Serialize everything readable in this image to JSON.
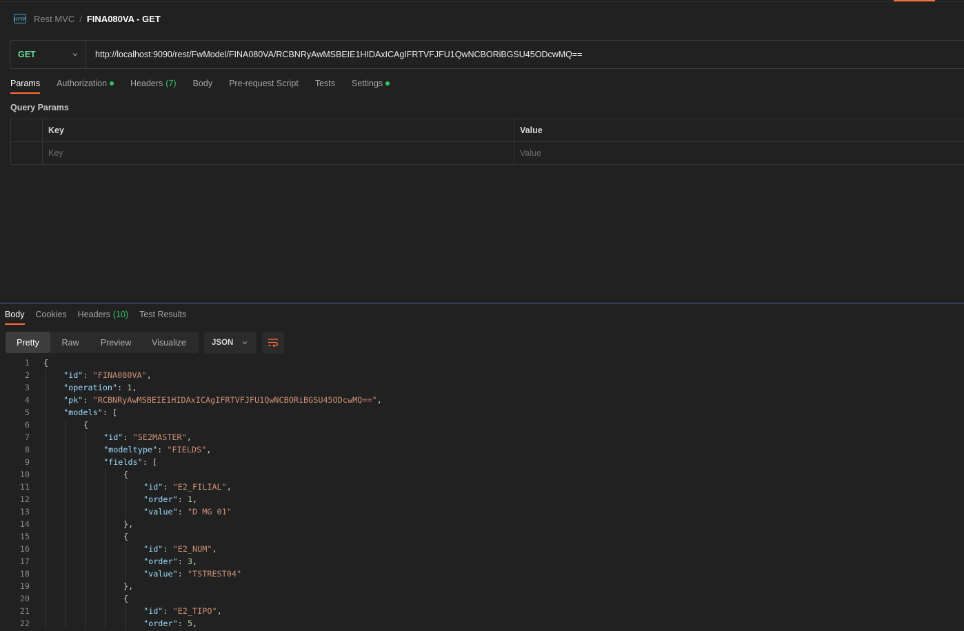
{
  "breadcrumb": {
    "parent": "Rest MVC",
    "separator": "/",
    "current": "FINA080VA - GET"
  },
  "request": {
    "method": "GET",
    "url": "http://localhost:9090/rest/FwModel/FINA080VA/RCBNRyAwMSBEIE1HIDAxICAgIFRTVFJFU1QwNCBORiBGSU45ODcwMQ=="
  },
  "request_tabs": [
    {
      "label": "Params",
      "active": true
    },
    {
      "label": "Authorization",
      "dot": true
    },
    {
      "label": "Headers",
      "count": "(7)"
    },
    {
      "label": "Body"
    },
    {
      "label": "Pre-request Script"
    },
    {
      "label": "Tests"
    },
    {
      "label": "Settings",
      "dot": true
    }
  ],
  "query_params": {
    "title": "Query Params",
    "header_key": "Key",
    "header_value": "Value",
    "placeholder_key": "Key",
    "placeholder_value": "Value"
  },
  "response_tabs": [
    {
      "label": "Body",
      "active": true
    },
    {
      "label": "Cookies"
    },
    {
      "label": "Headers",
      "count": "(10)"
    },
    {
      "label": "Test Results"
    }
  ],
  "viewer": {
    "modes": [
      "Pretty",
      "Raw",
      "Preview",
      "Visualize"
    ],
    "active_mode": "Pretty",
    "format": "JSON",
    "wrap_icon": "wrap-lines-icon"
  },
  "colors": {
    "accent": "#ff6c37",
    "method_get": "#6bdd9a",
    "status_dot": "#2fc768",
    "json_key": "#9cdcfe",
    "json_string": "#ce9178",
    "json_number": "#b5cea8"
  },
  "code_lines": [
    {
      "n": "1",
      "indent": 0,
      "parts": [
        [
          "p",
          "{"
        ]
      ]
    },
    {
      "n": "2",
      "indent": 1,
      "parts": [
        [
          "k",
          "\"id\""
        ],
        [
          "p",
          ": "
        ],
        [
          "s",
          "\"FINA080VA\""
        ],
        [
          "p",
          ","
        ]
      ]
    },
    {
      "n": "3",
      "indent": 1,
      "parts": [
        [
          "k",
          "\"operation\""
        ],
        [
          "p",
          ": "
        ],
        [
          "n",
          "1"
        ],
        [
          "p",
          ","
        ]
      ]
    },
    {
      "n": "4",
      "indent": 1,
      "parts": [
        [
          "k",
          "\"pk\""
        ],
        [
          "p",
          ": "
        ],
        [
          "s",
          "\"RCBNRyAwMSBEIE1HIDAxICAgIFRTVFJFU1QwNCBORiBGSU45ODcwMQ==\""
        ],
        [
          "p",
          ","
        ]
      ]
    },
    {
      "n": "5",
      "indent": 1,
      "parts": [
        [
          "k",
          "\"models\""
        ],
        [
          "p",
          ": ["
        ]
      ]
    },
    {
      "n": "6",
      "indent": 2,
      "parts": [
        [
          "p",
          "{"
        ]
      ]
    },
    {
      "n": "7",
      "indent": 3,
      "parts": [
        [
          "k",
          "\"id\""
        ],
        [
          "p",
          ": "
        ],
        [
          "s",
          "\"SE2MASTER\""
        ],
        [
          "p",
          ","
        ]
      ]
    },
    {
      "n": "8",
      "indent": 3,
      "parts": [
        [
          "k",
          "\"modeltype\""
        ],
        [
          "p",
          ": "
        ],
        [
          "s",
          "\"FIELDS\""
        ],
        [
          "p",
          ","
        ]
      ]
    },
    {
      "n": "9",
      "indent": 3,
      "parts": [
        [
          "k",
          "\"fields\""
        ],
        [
          "p",
          ": ["
        ]
      ]
    },
    {
      "n": "10",
      "indent": 4,
      "parts": [
        [
          "p",
          "{"
        ]
      ]
    },
    {
      "n": "11",
      "indent": 5,
      "parts": [
        [
          "k",
          "\"id\""
        ],
        [
          "p",
          ": "
        ],
        [
          "s",
          "\"E2_FILIAL\""
        ],
        [
          "p",
          ","
        ]
      ]
    },
    {
      "n": "12",
      "indent": 5,
      "parts": [
        [
          "k",
          "\"order\""
        ],
        [
          "p",
          ": "
        ],
        [
          "n",
          "1"
        ],
        [
          "p",
          ","
        ]
      ]
    },
    {
      "n": "13",
      "indent": 5,
      "parts": [
        [
          "k",
          "\"value\""
        ],
        [
          "p",
          ": "
        ],
        [
          "s",
          "\"D MG 01\""
        ]
      ]
    },
    {
      "n": "14",
      "indent": 4,
      "parts": [
        [
          "p",
          "},"
        ]
      ]
    },
    {
      "n": "15",
      "indent": 4,
      "parts": [
        [
          "p",
          "{"
        ]
      ]
    },
    {
      "n": "16",
      "indent": 5,
      "parts": [
        [
          "k",
          "\"id\""
        ],
        [
          "p",
          ": "
        ],
        [
          "s",
          "\"E2_NUM\""
        ],
        [
          "p",
          ","
        ]
      ]
    },
    {
      "n": "17",
      "indent": 5,
      "parts": [
        [
          "k",
          "\"order\""
        ],
        [
          "p",
          ": "
        ],
        [
          "n",
          "3"
        ],
        [
          "p",
          ","
        ]
      ]
    },
    {
      "n": "18",
      "indent": 5,
      "parts": [
        [
          "k",
          "\"value\""
        ],
        [
          "p",
          ": "
        ],
        [
          "s",
          "\"TSTREST04\""
        ]
      ]
    },
    {
      "n": "19",
      "indent": 4,
      "parts": [
        [
          "p",
          "},"
        ]
      ]
    },
    {
      "n": "20",
      "indent": 4,
      "parts": [
        [
          "p",
          "{"
        ]
      ]
    },
    {
      "n": "21",
      "indent": 5,
      "parts": [
        [
          "k",
          "\"id\""
        ],
        [
          "p",
          ": "
        ],
        [
          "s",
          "\"E2_TIPO\""
        ],
        [
          "p",
          ","
        ]
      ]
    },
    {
      "n": "22",
      "indent": 5,
      "parts": [
        [
          "k",
          "\"order\""
        ],
        [
          "p",
          ": "
        ],
        [
          "n",
          "5"
        ],
        [
          "p",
          ","
        ]
      ]
    }
  ]
}
